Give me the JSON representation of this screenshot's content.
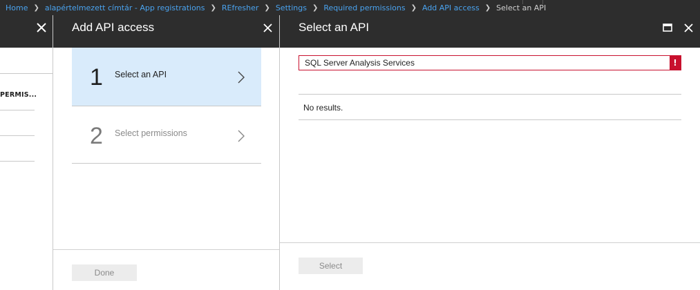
{
  "breadcrumb": {
    "items": [
      {
        "label": "Home"
      },
      {
        "label": "alapértelmezett címtár - App registrations"
      },
      {
        "label": "REfresher"
      },
      {
        "label": "Settings"
      },
      {
        "label": "Required permissions"
      },
      {
        "label": "Add API access"
      },
      {
        "label": "Select an API"
      }
    ]
  },
  "blade_permissions": {
    "column_header": "PERMIS..."
  },
  "blade_add_api": {
    "title": "Add API access",
    "steps": [
      {
        "number": "1",
        "label": "Select an API",
        "active": true
      },
      {
        "number": "2",
        "label": "Select permissions",
        "active": false
      }
    ],
    "done_label": "Done"
  },
  "blade_select_api": {
    "title": "Select an API",
    "search_value": "SQL Server Analysis Services",
    "error_glyph": "!",
    "no_results": "No results.",
    "select_label": "Select"
  },
  "colors": {
    "header_bg": "#2d2d2d",
    "link": "#4aa3ef",
    "active_step_bg": "#d9ebfb",
    "error": "#c8102e"
  }
}
